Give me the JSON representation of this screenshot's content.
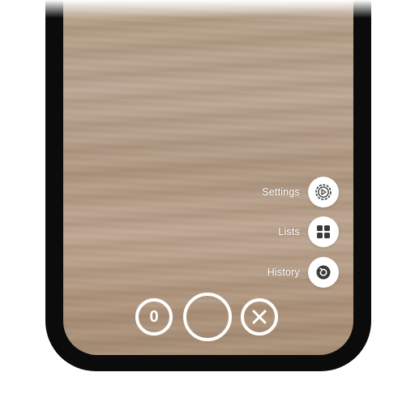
{
  "menu": {
    "settings_label": "Settings",
    "lists_label": "Lists",
    "history_label": "History"
  },
  "controls": {
    "item_count": "0"
  },
  "icons": {
    "settings": "gear-icon",
    "lists": "grid-icon",
    "history": "history-icon",
    "close": "close-icon"
  },
  "colors": {
    "overlay_text": "#ffffff",
    "phone_frame": "#0b0b0b",
    "icon_dark": "#3a3a3a"
  }
}
